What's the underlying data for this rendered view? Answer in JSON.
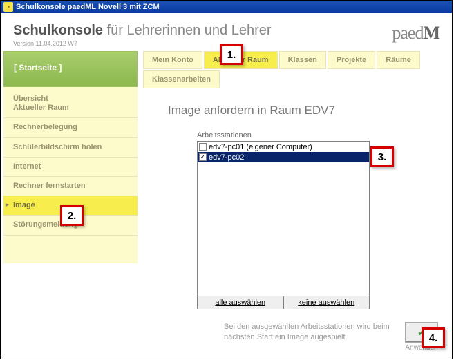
{
  "window": {
    "title": "Schulkonsole paedML Novell 3 mit ZCM"
  },
  "header": {
    "app_bold": "Schulkonsole",
    "app_light": "für Lehrerinnen und Lehrer",
    "version": "Version 11.04.2012 W7",
    "brand_thin": "paed",
    "brand_bold": "M"
  },
  "startseite": "[ Startseite ]",
  "sidebar": {
    "items": [
      {
        "label": "Übersicht\nAktueller Raum",
        "active": false
      },
      {
        "label": "Rechnerbelegung",
        "active": false
      },
      {
        "label": "Schülerbildschirm holen",
        "active": false
      },
      {
        "label": "Internet",
        "active": false
      },
      {
        "label": "Rechner fernstarten",
        "active": false
      },
      {
        "label": "Image",
        "active": true
      },
      {
        "label": "Störungsmeldung",
        "active": false
      }
    ]
  },
  "tabs": {
    "row1": [
      {
        "label": "Mein Konto",
        "active": false
      },
      {
        "label": "Aktueller Raum",
        "active": true
      },
      {
        "label": "Klassen",
        "active": false
      },
      {
        "label": "Projekte",
        "active": false
      },
      {
        "label": "Räume",
        "active": false
      }
    ],
    "row2": [
      {
        "label": "Klassenarbeiten",
        "active": false
      }
    ]
  },
  "content": {
    "heading": "Image anfordern in Raum EDV7",
    "ws_label": "Arbeitsstationen",
    "workstations": [
      {
        "label": "edv7-pc01 (eigener Computer)",
        "checked": false,
        "selected": false
      },
      {
        "label": "edv7-pc02",
        "checked": true,
        "selected": true
      }
    ],
    "select_all": "alle auswählen",
    "select_none": "keine auswählen",
    "footer_text": "Bei den ausgewählten Arbeitsstationen wird beim nächsten Start ein Image augespielt.",
    "apply_label": "Anwenden",
    "apply_glyph": "✓"
  },
  "callouts": {
    "c1": "1.",
    "c2": "2.",
    "c3": "3.",
    "c4": "4."
  }
}
